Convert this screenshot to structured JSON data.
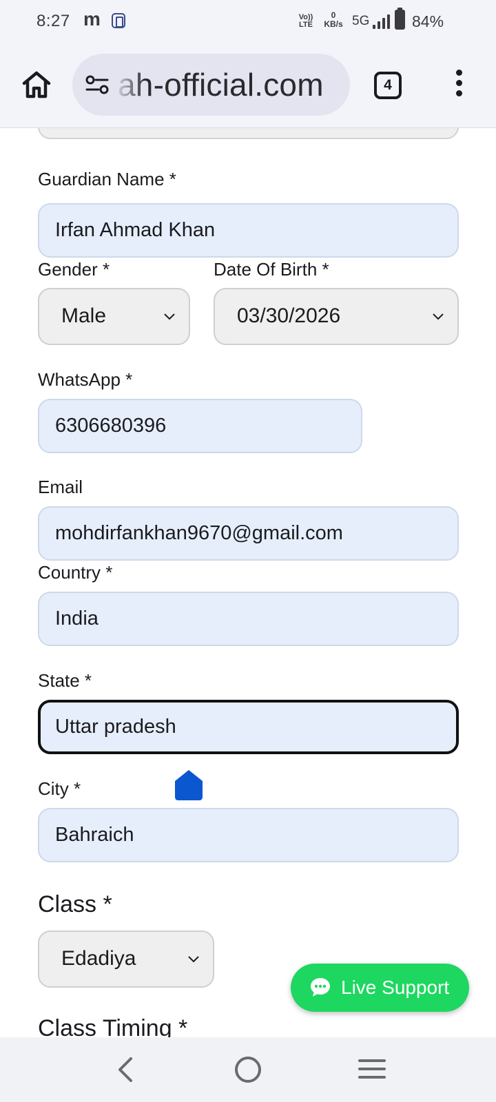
{
  "status_bar": {
    "time": "8:27",
    "app_letter": "m",
    "volte_line1": "Vo))",
    "volte_line2": "LTE",
    "speed_value": "0",
    "speed_unit": "KB/s",
    "network": "5G",
    "battery": "84%"
  },
  "browser": {
    "url": "ah-official.com",
    "tab_count": "4"
  },
  "form": {
    "guardian_name": {
      "label": "Guardian Name *",
      "value": "Irfan Ahmad Khan"
    },
    "gender": {
      "label": "Gender *",
      "value": "Male"
    },
    "dob": {
      "label": "Date Of Birth *",
      "value": "03/30/2026"
    },
    "whatsapp": {
      "label": "WhatsApp *",
      "value": "6306680396"
    },
    "email": {
      "label": "Email",
      "value": "mohdirfankhan9670@gmail.com"
    },
    "country": {
      "label": "Country *",
      "value": "India"
    },
    "state": {
      "label": "State *",
      "value": "Uttar pradesh"
    },
    "city": {
      "label": "City *",
      "value": "Bahraich"
    },
    "class": {
      "label": "Class *",
      "value": "Edadiya"
    },
    "class_timing": {
      "label": "Class Timing *"
    }
  },
  "live_support": {
    "label": "Live Support"
  },
  "colors": {
    "field_fill": "#e6eefc",
    "select_fill": "#efefef",
    "live_support": "#1ed760",
    "caret_handle": "#0b57d0"
  },
  "icons": [
    "home-icon",
    "site-settings-icon",
    "tab-switcher-icon",
    "more-menu-icon",
    "chevron-down-icon",
    "chat-bubble-icon",
    "nav-back-icon",
    "nav-home-icon",
    "nav-recents-icon"
  ]
}
